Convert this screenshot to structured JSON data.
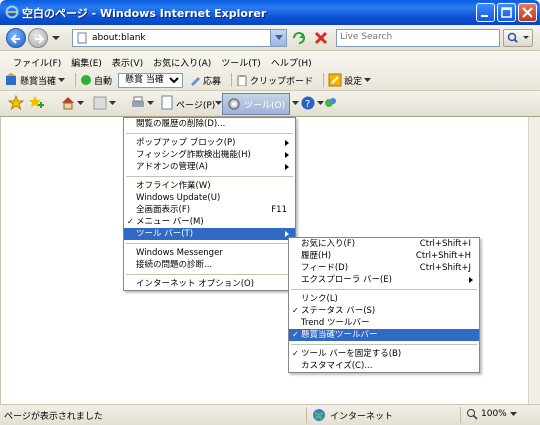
{
  "window": {
    "title": "空白のページ - Windows Internet Explorer"
  },
  "address": {
    "value": "about:blank"
  },
  "search": {
    "placeholder": "Live Search"
  },
  "menubar": {
    "items": [
      "ファイル(F)",
      "編集(E)",
      "表示(V)",
      "お気に入り(A)",
      "ツール(T)",
      "ヘルプ(H)"
    ]
  },
  "toolbar": {
    "brand": "懸賞当確",
    "auto": "自動",
    "select_value": "懸賞 当確",
    "apply": "応募",
    "clipboard": "クリップボード",
    "settings": "設定"
  },
  "cmdbar": {
    "page": "ページ(P)",
    "tools": "ツール(O)"
  },
  "tools_menu": {
    "items": [
      {
        "label": "閲覧の履歴の削除(D)...",
        "shortcut": "",
        "submenu": false,
        "check": ""
      },
      {
        "sep": true
      },
      {
        "label": "ポップアップ ブロック(P)",
        "shortcut": "",
        "submenu": true,
        "check": ""
      },
      {
        "label": "フィッシング詐欺検出機能(H)",
        "shortcut": "",
        "submenu": true,
        "check": ""
      },
      {
        "label": "アドオンの管理(A)",
        "shortcut": "",
        "submenu": true,
        "check": ""
      },
      {
        "sep": true
      },
      {
        "label": "オフライン作業(W)",
        "shortcut": "",
        "submenu": false,
        "check": ""
      },
      {
        "label": "Windows Update(U)",
        "shortcut": "",
        "submenu": false,
        "check": ""
      },
      {
        "label": "全画面表示(F)",
        "shortcut": "F11",
        "submenu": false,
        "check": ""
      },
      {
        "label": "メニュー バー(M)",
        "shortcut": "",
        "submenu": false,
        "check": "✓"
      },
      {
        "label": "ツール バー(T)",
        "shortcut": "",
        "submenu": true,
        "check": "",
        "highlight": true
      },
      {
        "sep": true
      },
      {
        "label": "Windows Messenger",
        "shortcut": "",
        "submenu": false,
        "check": ""
      },
      {
        "label": "接続の問題の診断...",
        "shortcut": "",
        "submenu": false,
        "check": ""
      },
      {
        "sep": true
      },
      {
        "label": "インターネット オプション(O)",
        "shortcut": "",
        "submenu": false,
        "check": ""
      }
    ]
  },
  "toolbars_menu": {
    "items": [
      {
        "label": "お気に入り(F)",
        "shortcut": "Ctrl+Shift+I",
        "submenu": false,
        "check": ""
      },
      {
        "label": "履歴(H)",
        "shortcut": "Ctrl+Shift+H",
        "submenu": false,
        "check": ""
      },
      {
        "label": "フィード(D)",
        "shortcut": "Ctrl+Shift+J",
        "submenu": false,
        "check": ""
      },
      {
        "label": "エクスプローラ バー(E)",
        "shortcut": "",
        "submenu": true,
        "check": ""
      },
      {
        "sep": true
      },
      {
        "label": "リンク(L)",
        "shortcut": "",
        "submenu": false,
        "check": ""
      },
      {
        "label": "ステータス バー(S)",
        "shortcut": "",
        "submenu": false,
        "check": "✓"
      },
      {
        "label": "Trend ツールバー",
        "shortcut": "",
        "submenu": false,
        "check": ""
      },
      {
        "label": "懸賞当確ツールバー",
        "shortcut": "",
        "submenu": false,
        "check": "✓",
        "highlight": true
      },
      {
        "sep": true
      },
      {
        "label": "ツール バーを固定する(B)",
        "shortcut": "",
        "submenu": false,
        "check": "✓"
      },
      {
        "label": "カスタマイズ(C)...",
        "shortcut": "",
        "submenu": false,
        "check": ""
      }
    ]
  },
  "status": {
    "text": "ページが表示されました",
    "zone": "インターネット",
    "zoom": "100%"
  },
  "colors": {
    "title_blue": "#0a5ee0",
    "highlight": "#316ac5"
  }
}
